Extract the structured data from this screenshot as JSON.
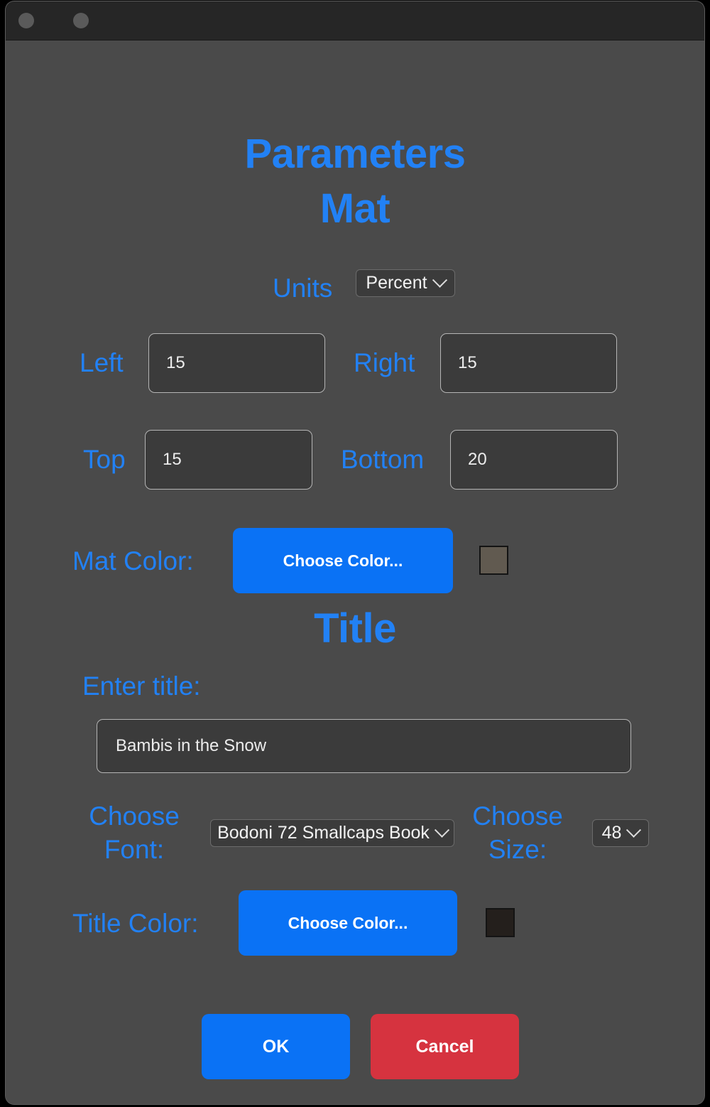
{
  "window": {
    "traffic_lights": [
      "close",
      "minimize"
    ]
  },
  "headings": {
    "main": "Parameters",
    "section_mat": "Mat",
    "section_title": "Title"
  },
  "mat": {
    "units_label": "Units",
    "units_value": "Percent",
    "units_options": [
      "Percent"
    ],
    "left_label": "Left",
    "left_value": "15",
    "right_label": "Right",
    "right_value": "15",
    "top_label": "Top",
    "top_value": "15",
    "bottom_label": "Bottom",
    "bottom_value": "20",
    "mat_color_label": "Mat Color:",
    "mat_color_button": "Choose Color...",
    "mat_color_swatch": "#615a50"
  },
  "title": {
    "enter_title_label": "Enter title:",
    "title_value": "Bambis in the Snow",
    "title_placeholder": "",
    "choose_font_label": "Choose Font:",
    "font_value": "Bodoni 72 Smallcaps Book",
    "font_options": [
      "Bodoni 72 Smallcaps Book"
    ],
    "choose_size_label": "Choose Size:",
    "size_value": "48",
    "size_options": [
      "48"
    ],
    "title_color_label": "Title Color:",
    "title_color_button": "Choose Color...",
    "title_color_swatch": "#241f1c"
  },
  "actions": {
    "ok_label": "OK",
    "cancel_label": "Cancel"
  },
  "colors": {
    "accent_blue": "#2281f5",
    "button_blue": "#0a72f5",
    "danger_red": "#d6333f",
    "window_bg": "#4a4a4a",
    "titlebar_bg": "#262626",
    "field_bg": "#3b3b3b"
  },
  "icons": {
    "chevron_down": "chevron-down-icon"
  }
}
